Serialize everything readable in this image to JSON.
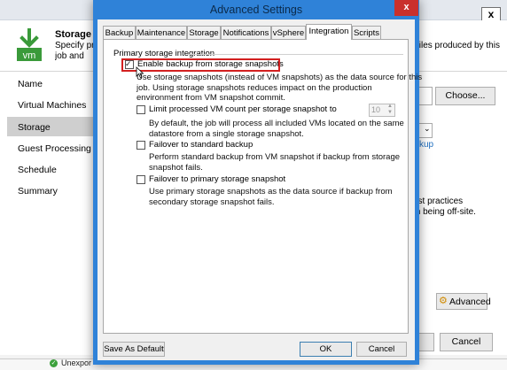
{
  "background_wizard": {
    "step_title": "Storage",
    "step_description": "Specify pr job and cu",
    "description_right": "files produced by this",
    "steps": [
      "Name",
      "Virtual Machines",
      "Storage",
      "Guest Processing",
      "Schedule",
      "Summary"
    ],
    "choose_button": "Choose...",
    "link_fragment": "kup",
    "right_text_line1": "est practices",
    "right_text_line2": "m being off-site.",
    "advanced_button": "Advanced",
    "cancel_button": "Cancel",
    "logo_text": "vm"
  },
  "bottom_strip": {
    "text": "Unexpor"
  },
  "dialog": {
    "title": "Advanced Settings",
    "close_glyph": "x",
    "tabs": [
      "Backup",
      "Maintenance",
      "Storage",
      "Notifications",
      "vSphere",
      "Integration",
      "Scripts"
    ],
    "active_tab": "Integration",
    "group_title": "Primary storage integration",
    "options": [
      {
        "label": "Enable backup from storage snapshots",
        "checked": true,
        "description": [
          "Use storage snapshots (instead of VM snapshots) as the data source for this",
          "job. Using storage snapshots reduces impact on the production",
          "environment from VM snapshot commit."
        ]
      },
      {
        "label": "Limit processed VM count per storage snapshot to",
        "checked": false,
        "spin_value": "10",
        "description": [
          "By default, the job will process all included VMs located on the same",
          "datastore from a single storage snapshot."
        ]
      },
      {
        "label": "Failover to standard backup",
        "checked": false,
        "description": [
          "Perform standard backup from VM snapshot if backup from storage",
          "snapshot fails."
        ]
      },
      {
        "label": "Failover to primary storage snapshot",
        "checked": false,
        "description": [
          "Use primary storage snapshots as the data source if backup from",
          "secondary storage snapshot fails."
        ]
      }
    ],
    "buttons": {
      "save_as_default": "Save As Default",
      "ok": "OK",
      "cancel": "Cancel"
    }
  },
  "colors": {
    "title_bar": "#2f82d8",
    "highlight": "#d32020",
    "close_button": "#c9302c",
    "veeam_green": "#3a9a3a"
  }
}
